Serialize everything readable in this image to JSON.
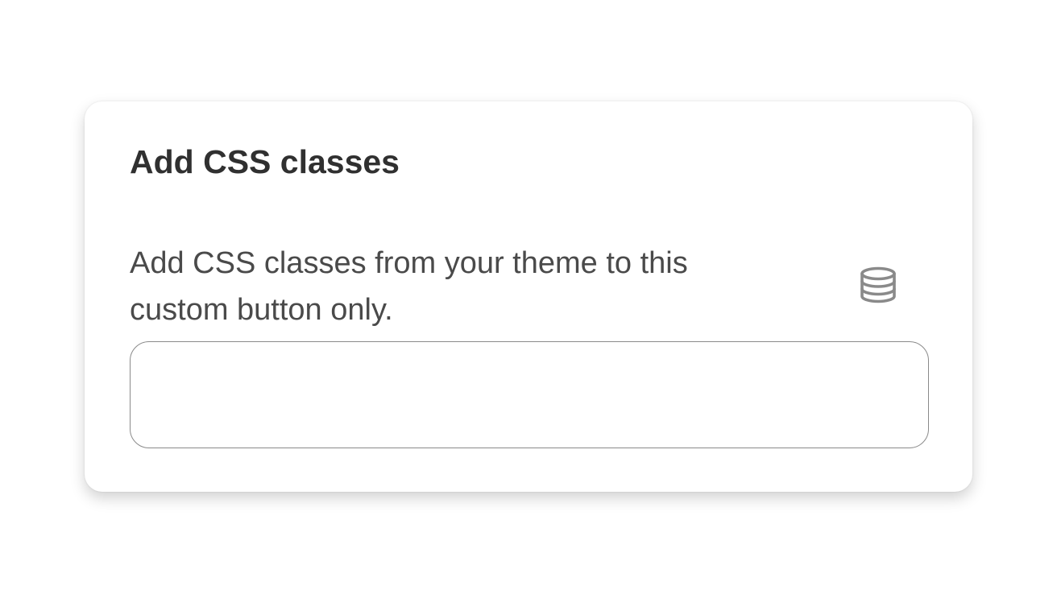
{
  "card": {
    "title": "Add CSS classes"
  },
  "field": {
    "label_line1": "Add CSS classes from your theme to this",
    "label_line2": "custom button only.",
    "value": "",
    "placeholder": ""
  },
  "icons": {
    "dynamic_source": "database-icon"
  },
  "colors": {
    "title": "#303030",
    "label": "#4a4a4a",
    "icon": "#8a8a8a",
    "input_border": "#8a8a8a"
  }
}
